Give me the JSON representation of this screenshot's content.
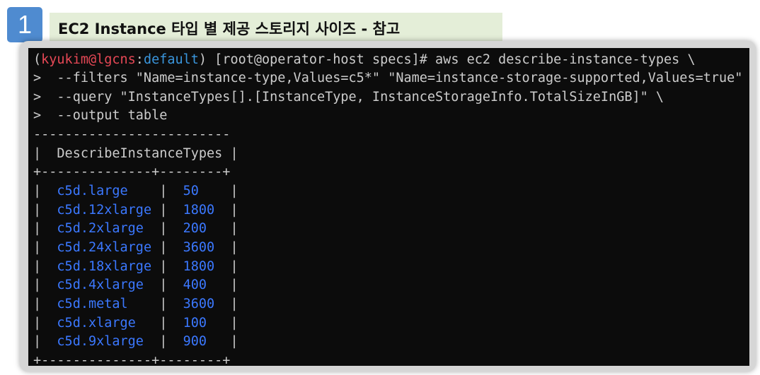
{
  "step": {
    "number": "1"
  },
  "title": "EC2 Instance 타입 별 제공 스토리지 사이즈 - 참고",
  "terminal": {
    "prompt_open": "(",
    "prompt_user": "kyukim@lgcns",
    "prompt_sep": ":",
    "prompt_ctx": "default",
    "prompt_rest": ") [root@operator-host specs]# aws ec2 describe-instance-types \\",
    "cont_lines": [
      ">  --filters \"Name=instance-type,Values=c5*\" \"Name=instance-storage-supported,Values=true\" \\",
      ">  --query \"InstanceTypes[].[InstanceType, InstanceStorageInfo.TotalSizeInGB]\" \\",
      ">  --output table"
    ],
    "table_top": "-------------------------",
    "table_title_row": "|  DescribeInstanceTypes |",
    "table_sep": "+--------------+--------+",
    "table_bottom": "+--------------+--------+",
    "rows": [
      {
        "type": "c5d.large",
        "size": "50"
      },
      {
        "type": "c5d.12xlarge",
        "size": "1800"
      },
      {
        "type": "c5d.2xlarge",
        "size": "200"
      },
      {
        "type": "c5d.24xlarge",
        "size": "3600"
      },
      {
        "type": "c5d.18xlarge",
        "size": "1800"
      },
      {
        "type": "c5d.4xlarge",
        "size": "400"
      },
      {
        "type": "c5d.metal",
        "size": "3600"
      },
      {
        "type": "c5d.xlarge",
        "size": "100"
      },
      {
        "type": "c5d.9xlarge",
        "size": "900"
      }
    ],
    "colors": {
      "user": "#e74856",
      "context": "#3a96dd",
      "values": "#3b78ff",
      "text": "#cccccc",
      "background": "#0c0c0c"
    }
  }
}
